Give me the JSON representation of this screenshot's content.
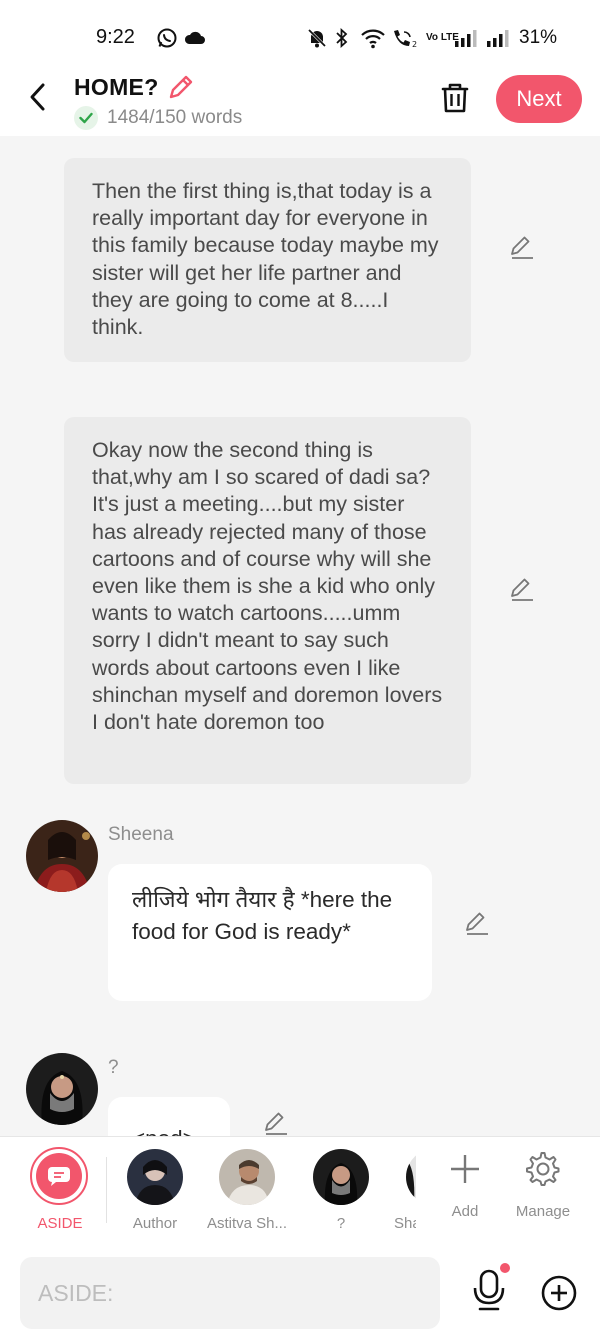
{
  "status": {
    "time": "9:22",
    "volte": "Vo LTE",
    "battery": "31%"
  },
  "header": {
    "title": "HOME?",
    "word_count": "1484/150 words",
    "next_label": "Next"
  },
  "feed": {
    "narration_1": "Then the first thing is,that today is a really important day for everyone in this family because today maybe my sister will get her life partner and they are going to come at 8.....I think.",
    "narration_2": "Okay now the second thing is that,why am I so scared of dadi sa?It's just a meeting....but my sister has already rejected many of those cartoons and of course why will she even like them is she a kid who only wants to watch cartoons.....umm sorry I didn't meant to say such words about cartoons even I like shinchan myself and doremon lovers I don't hate doremon too",
    "message_1": {
      "speaker": "Sheena",
      "text": "लीजिये भोग तैयार है *here the food for God is ready*"
    },
    "message_2": {
      "speaker": "?",
      "text": "<nod>"
    }
  },
  "characters": [
    {
      "label": "ASIDE"
    },
    {
      "label": "Author"
    },
    {
      "label": "Astitva Sh..."
    },
    {
      "label": "?"
    },
    {
      "label": "Sha"
    },
    {
      "label": "Add"
    },
    {
      "label": "Manage"
    }
  ],
  "input": {
    "placeholder": "ASIDE:"
  },
  "colors": {
    "accent": "#f2566c",
    "narration_bg": "#ebebeb",
    "background": "#f5f5f5"
  }
}
